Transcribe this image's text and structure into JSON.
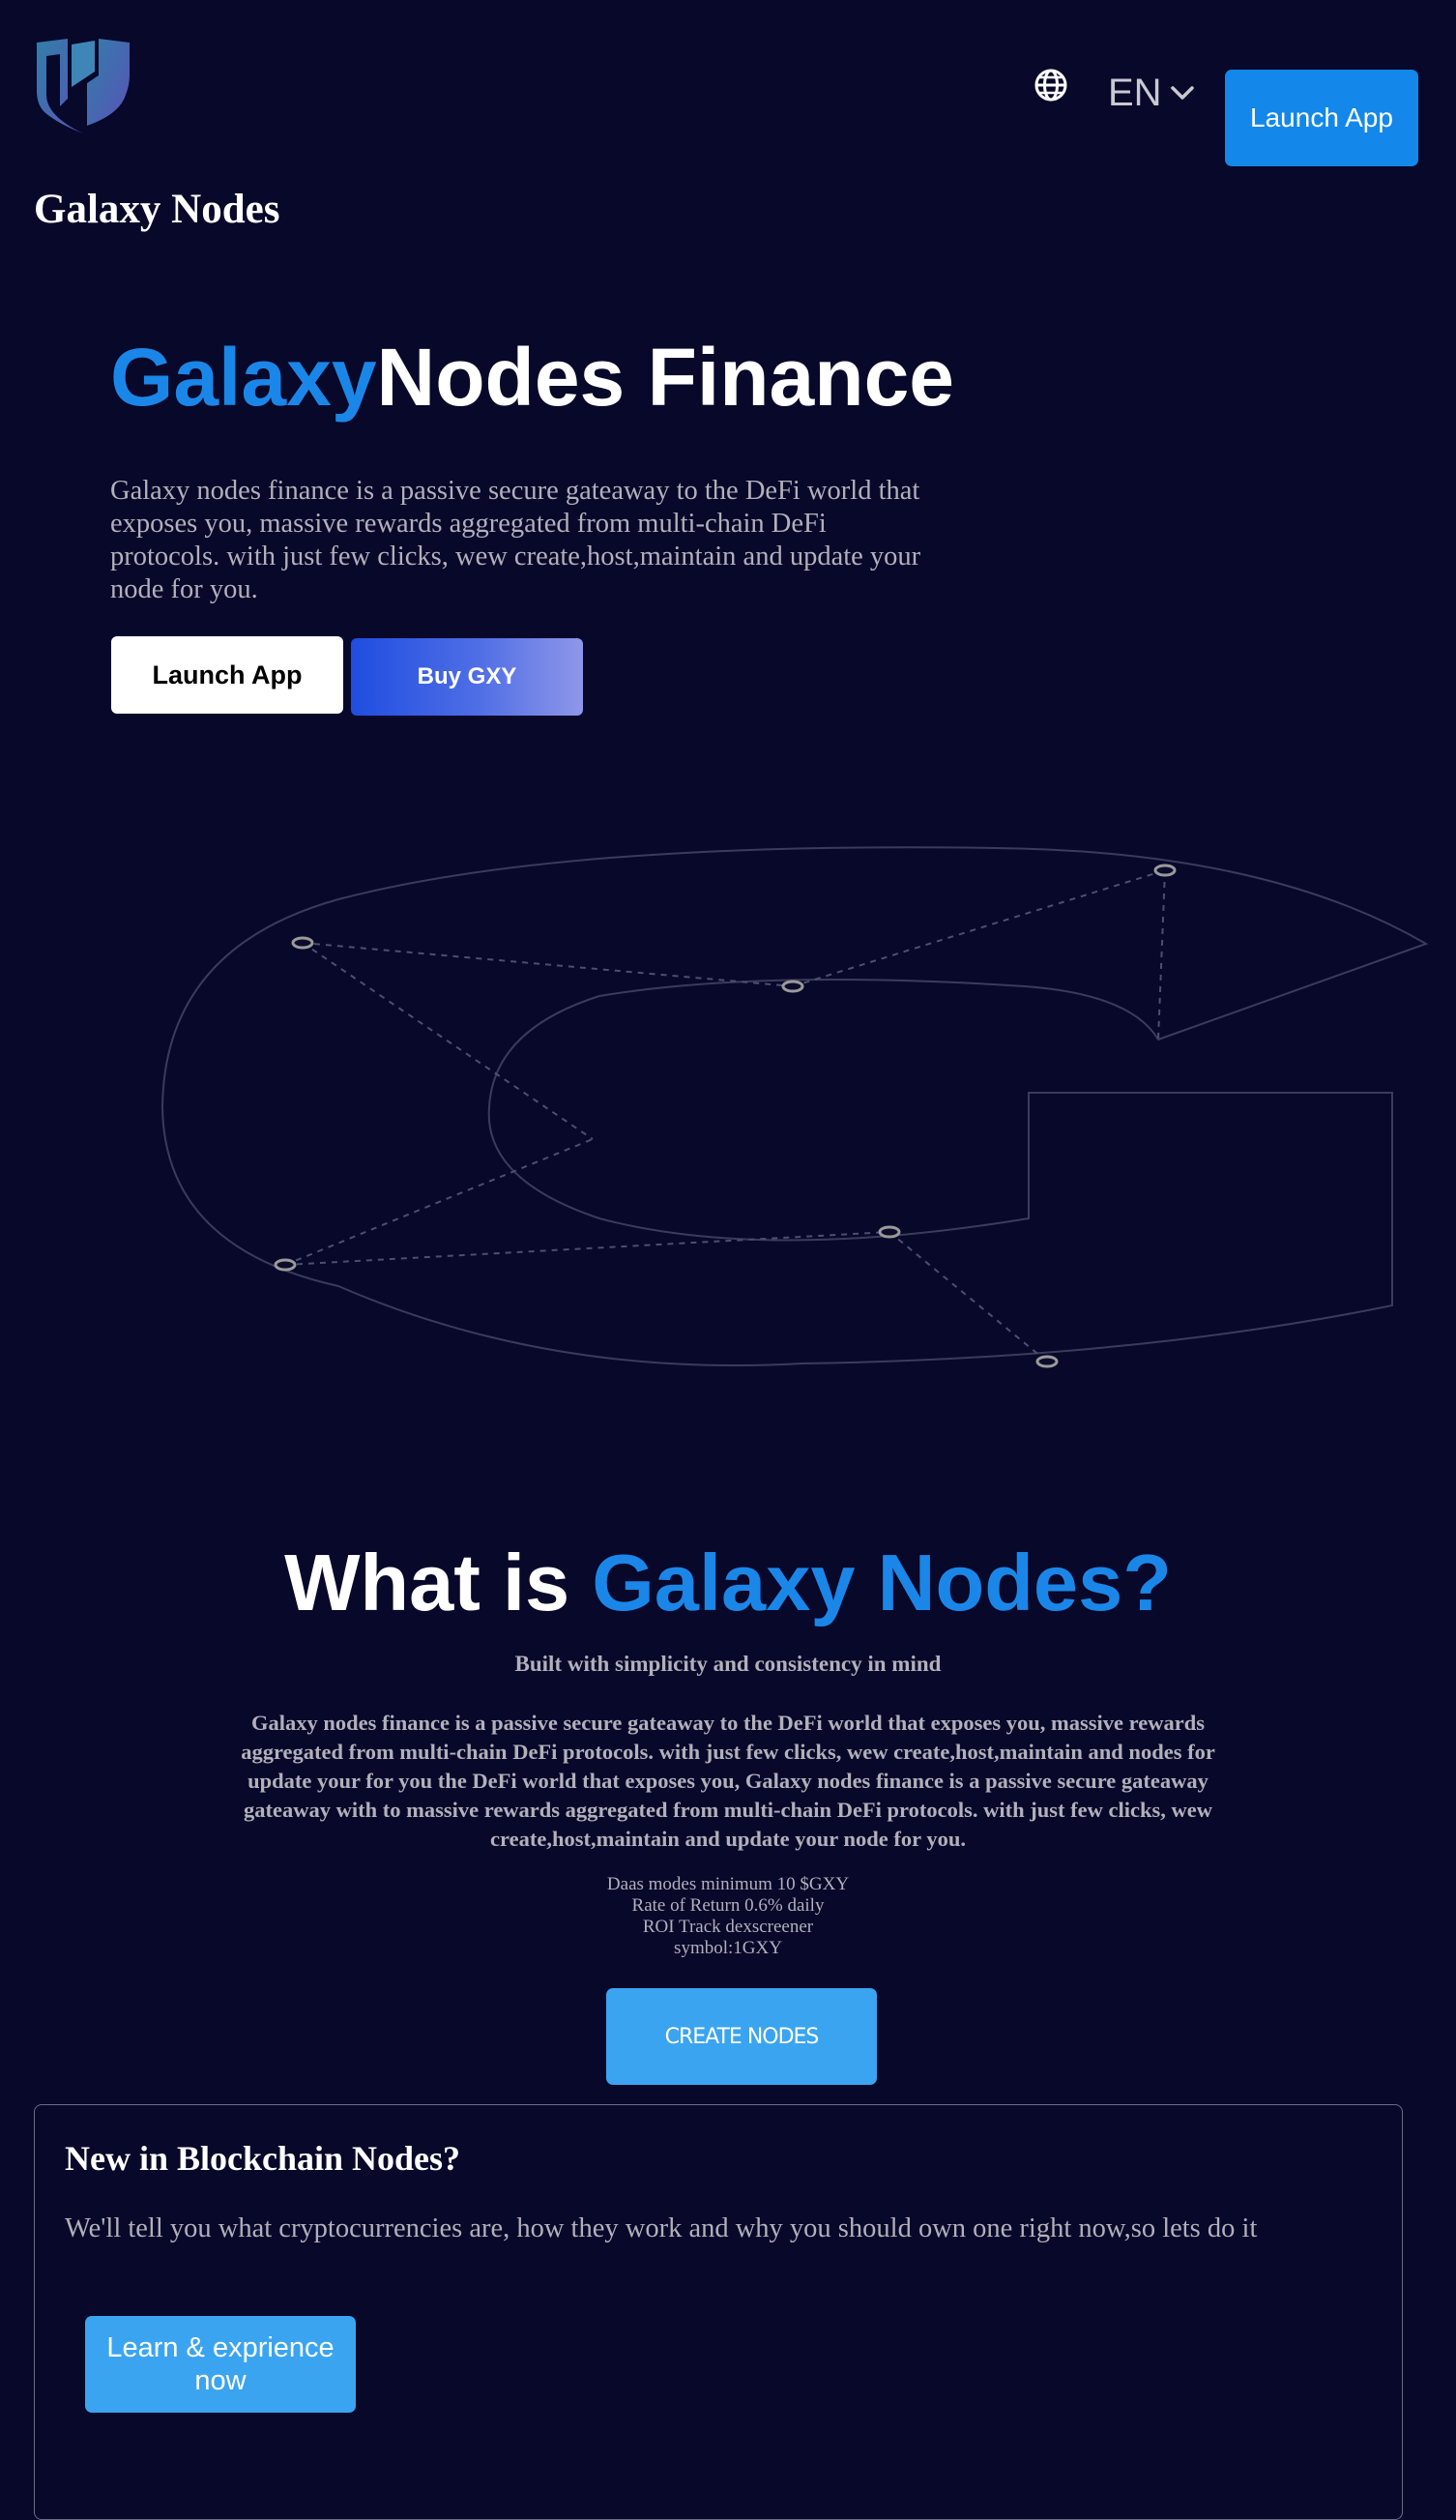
{
  "header": {
    "brand_name": "Galaxy Nodes",
    "logo_icon": "shield-logo-icon",
    "language_icon": "globe-icon",
    "language": "EN",
    "launch_button": "Launch App"
  },
  "hero": {
    "title_accent": "Galaxy",
    "title_rest": "Nodes Finance",
    "description": "Galaxy nodes finance is a passive secure gateaway to the DeFi world that exposes you, massive rewards aggregated from multi-chain DeFi protocols. with just few clicks, wew create,host,maintain and update your node for you.",
    "launch_button": "Launch App",
    "buy_button": "Buy GXY"
  },
  "about": {
    "title_prefix": "What is ",
    "title_accent": "Galaxy Nodes?",
    "subtitle": "Built with simplicity and consistency in mind",
    "description": "Galaxy nodes finance is a passive secure gateaway to the DeFi world that exposes you, massive rewards aggregated from multi-chain DeFi protocols. with just few clicks, wew create,host,maintain and nodes for update your for you the DeFi world that exposes you, Galaxy nodes finance is a passive secure gateaway gateaway with to massive rewards aggregated from multi-chain DeFi protocols. with just few clicks, wew create,host,maintain and update your node for you.",
    "stats": [
      "Daas modes minimum 10 $GXY",
      "Rate of Return 0.6% daily",
      "ROI Track dexscreener",
      "symbol:1GXY"
    ],
    "create_button": "CREATE NODES"
  },
  "card": {
    "title": "New in Blockchain Nodes?",
    "description": "We'll tell you what cryptocurrencies are, how they work and why you should own one right now,so lets do it",
    "button": "Learn & exprience now"
  },
  "colors": {
    "background": "#07082a",
    "accent_blue": "#1a87e8",
    "button_blue": "#3aa4f0",
    "muted_text": "#b2b0ba"
  }
}
